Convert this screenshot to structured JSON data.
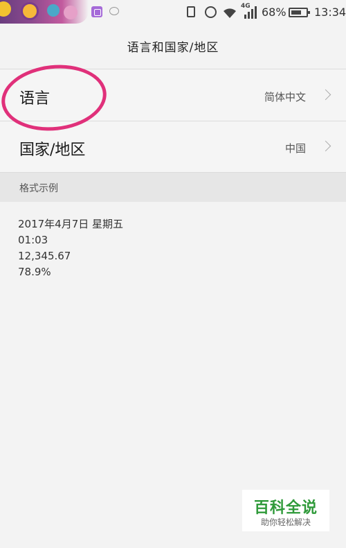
{
  "status_bar": {
    "network_type": "4G",
    "battery_percent": "68%",
    "battery_level": 0.68,
    "time": "13:34"
  },
  "header": {
    "title": "语言和国家/地区"
  },
  "settings": {
    "language": {
      "label": "语言",
      "value": "简体中文"
    },
    "region": {
      "label": "国家/地区",
      "value": "中国"
    }
  },
  "format_section": {
    "header": "格式示例",
    "examples": [
      "2017年4月7日 星期五",
      "01:03",
      "12,345.67",
      "78.9%"
    ]
  },
  "watermark": {
    "title": "百科全说",
    "subtitle": "助你轻松解决"
  },
  "colors": {
    "annotation": "#e0307a",
    "watermark_green": "#2f9a3a"
  }
}
